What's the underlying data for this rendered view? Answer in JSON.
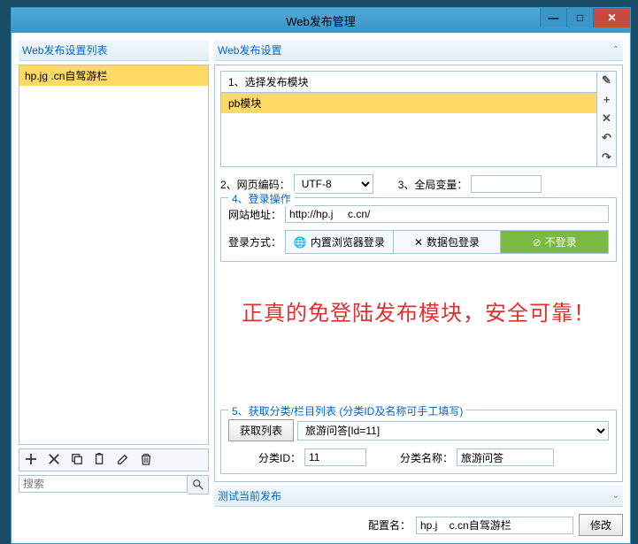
{
  "window": {
    "title": "Web发布管理"
  },
  "left": {
    "title": "Web发布设置列表",
    "items": [
      "hp.jg    .cn自驾游栏"
    ],
    "search_placeholder": "搜索"
  },
  "right": {
    "title": "Web发布设置",
    "module_header": "1、选择发布模块",
    "module_item": "pb模块",
    "encoding_label": "2、网页编码：",
    "encoding_value": "UTF-8",
    "global_var_label": "3、全局变量：",
    "global_var_value": "",
    "login": {
      "section_label": "4、登录操作",
      "url_label": "网站地址：",
      "url_value": "http://hp.j     c.cn/",
      "method_label": "登录方式：",
      "btn_browser": "内置浏览器登录",
      "btn_packet": "数据包登录",
      "btn_none": "不登录"
    },
    "overlay": "正真的免登陆发布模块，安全可靠！",
    "category": {
      "section_label": "5、获取分类/栏目列表  (分类ID及名称可手工填写)",
      "fetch_btn": "获取列表",
      "select_value": "旅游问答[Id=11]",
      "id_label": "分类ID：",
      "id_value": "11",
      "name_label": "分类名称：",
      "name_value": "旅游问答"
    },
    "test_title": "测试当前发布",
    "config_label": "配置名：",
    "config_value": "hp.j    c.cn自驾游栏",
    "modify_btn": "修改"
  }
}
